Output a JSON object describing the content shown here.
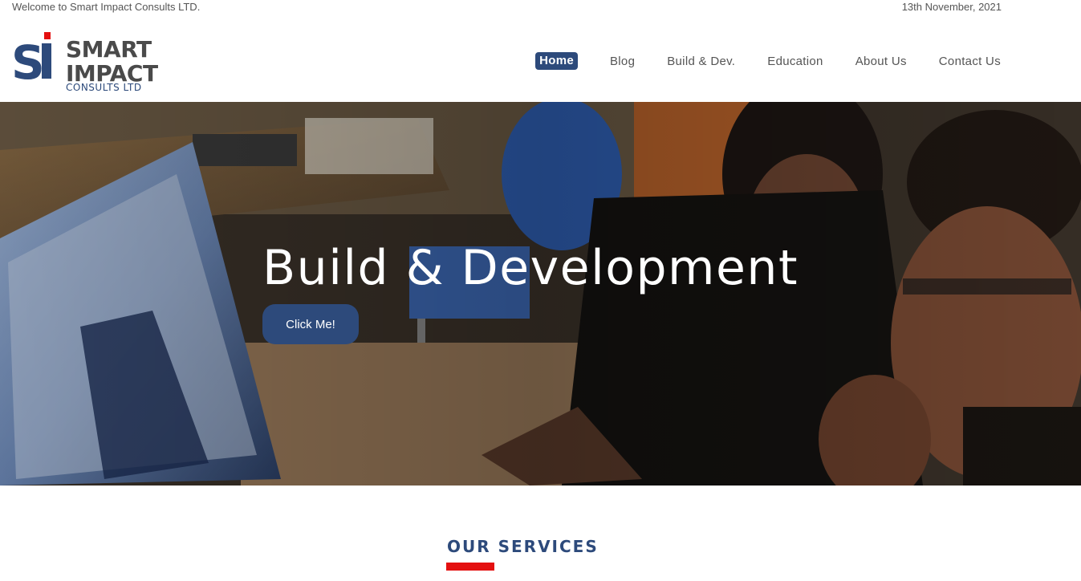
{
  "topbar": {
    "welcome_text": "Welcome to Smart Impact Consults LTD.",
    "date_text": "13th November, 2021"
  },
  "logo": {
    "mark": "SI",
    "line1": "SMART",
    "line2": "IMPACT",
    "line3": "CONSULTS LTD",
    "colors": {
      "navy": "#2d4a7b",
      "red": "#e41010",
      "gray": "#4a4a4a"
    }
  },
  "nav": {
    "items": [
      {
        "label": "Home",
        "active": true
      },
      {
        "label": "Blog",
        "active": false
      },
      {
        "label": "Build & Dev.",
        "active": false
      },
      {
        "label": "Education",
        "active": false
      },
      {
        "label": "About Us",
        "active": false
      },
      {
        "label": "Contact Us",
        "active": false
      }
    ]
  },
  "hero": {
    "title": "Build & Development",
    "button_label": "Click Me!",
    "image_subject": "two people working at a computer in an office"
  },
  "services": {
    "title": "OUR SERVICES",
    "accent_color": "#e41010"
  },
  "colors": {
    "brand_navy": "#2d4a7b",
    "accent_red": "#e41010",
    "text_gray": "#555555"
  }
}
